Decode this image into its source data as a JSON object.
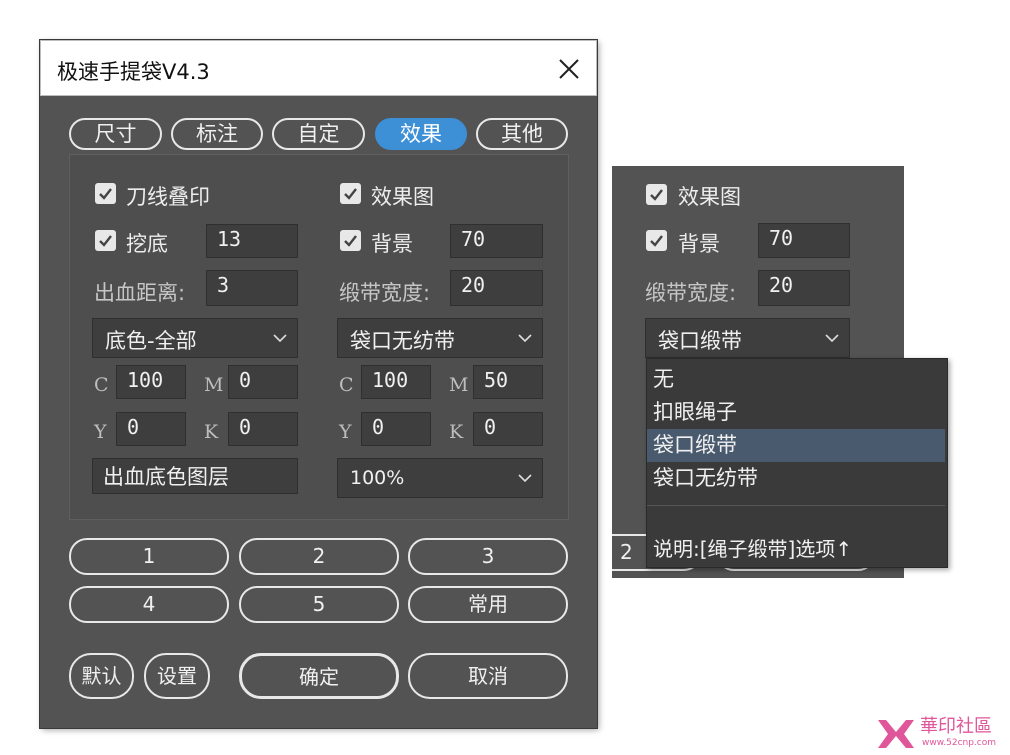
{
  "dialog": {
    "title": "极速手提袋V4.3",
    "tabs": [
      "尺寸",
      "标注",
      "自定",
      "效果",
      "其他"
    ],
    "active_tab": "效果",
    "left": {
      "knife_label": "刀线叠印",
      "dig_label": "挖底",
      "dig_value": "13",
      "bleed_label": "出血距离:",
      "bleed_value": "3",
      "bg_select": "底色-全部",
      "c_label": "C",
      "c_value": "100",
      "m_label": "M",
      "m_value": "0",
      "y_label": "Y",
      "y_value": "0",
      "k_label": "K",
      "k_value": "0",
      "layer_value": "出血底色图层"
    },
    "right": {
      "effect_label": "效果图",
      "bg_label": "背景",
      "bg_value": "70",
      "ribbon_width_label": "缎带宽度:",
      "ribbon_width_value": "20",
      "bag_select": "袋口无纺带",
      "c_label": "C",
      "c_value": "100",
      "m_label": "M",
      "m_value": "50",
      "y_label": "Y",
      "y_value": "0",
      "k_label": "K",
      "k_value": "0",
      "percent_select": "100%"
    },
    "presets": [
      "1",
      "2",
      "3",
      "4",
      "5",
      "常用"
    ],
    "default_label": "默认",
    "settings_label": "设置",
    "ok_label": "确定",
    "cancel_label": "取消"
  },
  "popup": {
    "effect_label": "效果图",
    "bg_label": "背景",
    "bg_value": "70",
    "ribbon_width_label": "缎带宽度:",
    "ribbon_width_value": "20",
    "bag_select": "袋口缎带",
    "options": [
      "无",
      "扣眼绳子",
      "袋口缎带",
      "袋口无纺带"
    ],
    "selected_option": "袋口缎带",
    "note": "说明:[绳子缎带]选项↑",
    "partial_button": "2"
  },
  "watermark": {
    "text": "華印社區",
    "url": "www.52cnp.com"
  },
  "colors": {
    "panel_bg": "#535353",
    "active_tab": "#3d8fd6",
    "field_bg": "#3e3e3e",
    "selected_option": "#495a6e"
  }
}
